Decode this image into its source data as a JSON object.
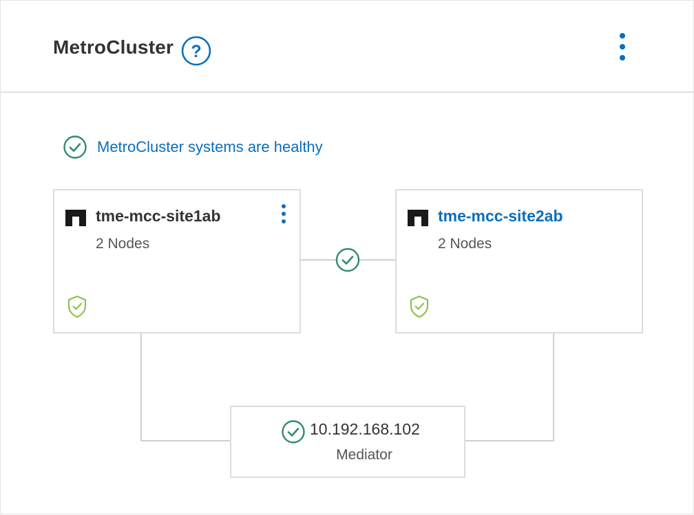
{
  "header": {
    "title": "MetroCluster",
    "help_icon": "help-circle-icon",
    "menu_icon": "vertical-ellipsis-icon"
  },
  "status": {
    "icon": "check-circle-icon",
    "text": "MetroCluster systems are healthy"
  },
  "sites": [
    {
      "name": "tme-mcc-site1ab",
      "nodes": "2 Nodes",
      "logo_icon": "netapp-logo-icon",
      "health_icon": "shield-check-icon",
      "menu_icon": "vertical-ellipsis-icon"
    },
    {
      "name": "tme-mcc-site2ab",
      "nodes": "2 Nodes",
      "logo_icon": "netapp-logo-icon",
      "health_icon": "shield-check-icon"
    }
  ],
  "connection": {
    "icon": "check-circle-icon"
  },
  "mediator": {
    "ip": "10.192.168.102",
    "label": "Mediator",
    "icon": "check-circle-icon"
  },
  "colors": {
    "accent_blue": "#0a6ebd",
    "healthy_teal": "#2e8b6e",
    "shield_green": "#8bc34a",
    "border": "#dcdcdc",
    "text_dark": "#333333"
  }
}
